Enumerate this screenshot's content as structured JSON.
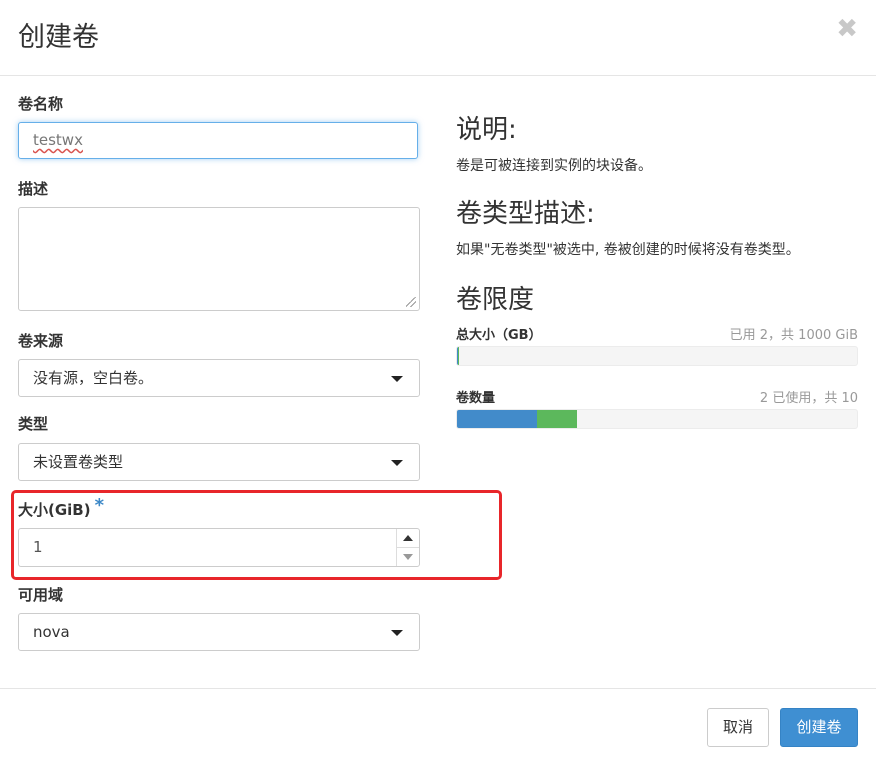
{
  "dialog": {
    "title": "创建卷",
    "close_glyph": "✖"
  },
  "form": {
    "name": {
      "label": "卷名称",
      "value": "testwx"
    },
    "description": {
      "label": "描述",
      "value": ""
    },
    "source": {
      "label": "卷来源",
      "selected": "没有源，空白卷。"
    },
    "type": {
      "label": "类型",
      "selected": "未设置卷类型"
    },
    "size": {
      "label": "大小(GiB)",
      "required_marker": "*",
      "value": "1"
    },
    "availability_zone": {
      "label": "可用域",
      "selected": "nova"
    }
  },
  "help": {
    "description_heading": "说明:",
    "description_text": "卷是可被连接到实例的块设备。",
    "type_heading": "卷类型描述:",
    "type_text": "如果\"无卷类型\"被选中, 卷被创建的时候将没有卷类型。",
    "limits_heading": "卷限度"
  },
  "quotas": {
    "total_size": {
      "label": "总大小（GB）",
      "meta": "已用 2，共 1000 GiB",
      "used": 2,
      "limit": 1000,
      "added": 1
    },
    "volume_count": {
      "label": "卷数量",
      "meta": "2 已使用，共 10",
      "used": 2,
      "limit": 10,
      "added": 1
    }
  },
  "footer": {
    "cancel_label": "取消",
    "submit_label": "创建卷"
  },
  "colors": {
    "bar_used": "#428bca",
    "bar_added": "#5cb85c",
    "highlight": "#e8262a",
    "primary": "#3f8fd2"
  }
}
